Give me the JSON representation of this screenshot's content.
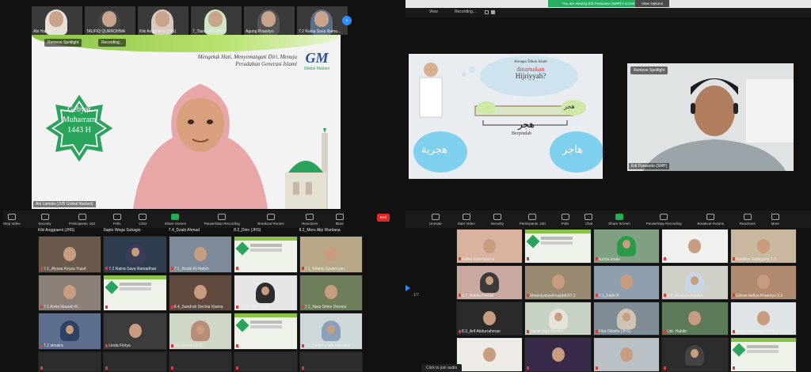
{
  "left": {
    "strip": [
      {
        "name": "Abi Habibi",
        "veil": "#e6e0d8"
      },
      {
        "name": "TAUFIQ QURROHMA",
        "veil": "#444"
      },
      {
        "name": "Kiki Anggraeni (JHS)",
        "veil": "#d9c9c0"
      },
      {
        "name": "7_Tiara Fitri (JHS)",
        "veil": "#cfe6c4"
      },
      {
        "name": "Agung Prasetyo",
        "veil": "#555"
      },
      {
        "name": "7.2 Raina Sava Rama...",
        "veil": "#5a6f8a"
      }
    ],
    "spotlight_chip": "Remove Spotlight",
    "recording_chip": "Recording...",
    "speaker": {
      "star_text_1": "Gebyar",
      "star_text_2": "Muharram",
      "star_text_3": "1443 H",
      "banner_1": "Mengetuk Hati, Menyemangati Diri, Menuju",
      "banner_2": "Peradaban Generasi Islami",
      "logo_main": "GM",
      "logo_sub": "Global Madani",
      "name": "Ani Lamida (JVB Global Madani)"
    },
    "toolbar": [
      {
        "label": "Stop Video"
      },
      {
        "label": "Security"
      },
      {
        "label": "Participants",
        "badge": "162"
      },
      {
        "label": "Polls"
      },
      {
        "label": "Chat"
      },
      {
        "label": "Share Screen",
        "share": true
      },
      {
        "label": "Pause/Stop Recording"
      },
      {
        "label": "Breakout Rooms"
      },
      {
        "label": "Reactions"
      },
      {
        "label": "More"
      }
    ],
    "grid_header": [
      {
        "name": "Kiki Anggraeni (JHS)"
      },
      {
        "name": "Sapto Wega Subagio"
      },
      {
        "name": "7.4_Dzaki Ahmad"
      },
      {
        "name": "8.2_Dirin (JHS)"
      },
      {
        "name": "8.2_Moru Alip Wardana"
      }
    ],
    "grid": [
      {
        "name": "7.1_Alyssa Keysa Yusuf",
        "kind": "face",
        "bg": "#6b5a4b"
      },
      {
        "name": "7.2 Raina Sava Ramadhan",
        "kind": "hij",
        "bg": "#2f3e4f",
        "veil": "#3b3b5a"
      },
      {
        "name": "7.1_Rusbi Al-Hafizh",
        "kind": "face",
        "bg": "#7d8a9a"
      },
      {
        "name": "ahmad ageng Zufard",
        "kind": "slide"
      },
      {
        "name": "7.1_Rifaldy Syahruyan",
        "kind": "face",
        "bg": "#b8a887"
      },
      {
        "name": "7.1 Areta Naurah R...",
        "kind": "face",
        "bg": "#8a8078"
      },
      {
        "name": "7.1_Naula Alifa Zahra",
        "kind": "slide"
      },
      {
        "name": "8.4_Sandrah Dechia Utama",
        "kind": "face",
        "bg": "#5f4a3d"
      },
      {
        "name": "7.3_Rafika Intan",
        "kind": "hij",
        "bg": "#e6e6e6",
        "veil": "#2d2d2d"
      },
      {
        "name": "7.1_Nara Shine Dwovia",
        "kind": "face",
        "bg": "#6e7e5a"
      },
      {
        "name": "7.2 almaira",
        "kind": "hij",
        "bg": "#5d6e8c",
        "veil": "#2f4266"
      },
      {
        "name": "Linda Fitriya",
        "kind": "face",
        "bg": "#3c3c3c"
      },
      {
        "name": "Ms. Gresti (JHS)",
        "kind": "hij",
        "bg": "#cfd8c7",
        "veil": "#b98c7a"
      },
      {
        "name": "8_Mch. Dafi Pangestu",
        "kind": "slide"
      },
      {
        "name": "7.2_Balqis shafa salsabila",
        "kind": "hij",
        "bg": "#ced7d9",
        "veil": "#8aa0b8"
      }
    ],
    "grid_bottom": [
      {
        "name": ""
      },
      {
        "name": ""
      },
      {
        "name": ""
      },
      {
        "name": ""
      },
      {
        "name": ""
      }
    ]
  },
  "right": {
    "title": "Zoom Meeting",
    "view": "View",
    "recording": "Recording...",
    "viewing_banner": "You are viewing Edi Purwanto (SMP)'s screen",
    "view_options": "View Options",
    "slide": {
      "q1": "Kenapa Tahun Islam",
      "q2": "dinamakan",
      "q3": "Hijriyyah?",
      "ar_top": "هجر",
      "ar_mid": "هجر",
      "ar_left": "هجرية",
      "ar_right": "هاجر",
      "caption": "Berpindah"
    },
    "spotlight_chip": "Remove Spotlight",
    "edi_name": "Edi Purwanto (SMP)",
    "end_label": "End",
    "toolbar": [
      {
        "label": "Unmute"
      },
      {
        "label": "Start Video"
      },
      {
        "label": "Security"
      },
      {
        "label": "Participants",
        "badge": "160"
      },
      {
        "label": "Polls"
      },
      {
        "label": "Chat"
      },
      {
        "label": "Share Screen",
        "share": true
      },
      {
        "label": "Pause/Stop Recording"
      },
      {
        "label": "Breakout Rooms"
      },
      {
        "label": "Reactions"
      },
      {
        "label": "More"
      }
    ],
    "pager": "1/7",
    "grid": [
      {
        "name": "Ridha Rahmasona",
        "kind": "face",
        "bg": "#d9b2a0"
      },
      {
        "name": "Suswanto",
        "kind": "slide"
      },
      {
        "name": "kurnia anaw",
        "kind": "hij",
        "bg": "#7fa083",
        "veil": "#2b9a4a"
      },
      {
        "name": "6.3_Chamadira Agila",
        "kind": "face",
        "bg": "#f0f0ee"
      },
      {
        "name": "Randhia Sabagana 7.3",
        "kind": "face",
        "bg": "#c9b7a0"
      },
      {
        "name": "8.3_Nabila Pratiwi",
        "kind": "hij",
        "bg": "#c9a8a0",
        "veil": "#3a3a3a"
      },
      {
        "name": "khsanlyaisyahnajidah07.2",
        "kind": "face",
        "bg": "#9a8a72"
      },
      {
        "name": "7.1_Fathi R",
        "kind": "face",
        "bg": "#8f9fae"
      },
      {
        "name": "8.1_Athanya Hamidi",
        "kind": "hij",
        "bg": "#d0cfc8",
        "veil": "#c8d7e8"
      },
      {
        "name": "Gibran Aditya Prasetyo 9.3",
        "kind": "face",
        "bg": "#b08a6e"
      },
      {
        "name": "8.3_Arif Abdurrahman",
        "kind": "face",
        "bg": "#2a2a2a"
      },
      {
        "name": "Sarah Susi Meritka",
        "kind": "hij",
        "bg": "#c6d1c4",
        "veil": "#e6e2dc"
      },
      {
        "name": "Fika Oktafia (JHS)",
        "kind": "hij",
        "bg": "#7f8b95",
        "veil": "#d1c3b3"
      },
      {
        "name": "Ust. Habibi",
        "kind": "face",
        "bg": "#5d7a5a"
      },
      {
        "name": "Nadya Nishanani JHS",
        "kind": "face",
        "bg": "#dfe4e6"
      },
      {
        "name": "",
        "kind": "face",
        "bg": "#efece8"
      },
      {
        "name": "",
        "kind": "face",
        "bg": "#3a2a4a"
      },
      {
        "name": "",
        "kind": "face",
        "bg": "#b9c0c6"
      },
      {
        "name": "",
        "kind": "hij",
        "bg": "#2c2c2c",
        "veil": "#444"
      },
      {
        "name": "",
        "kind": "slide"
      }
    ],
    "click_audio": "Click to join audio"
  }
}
